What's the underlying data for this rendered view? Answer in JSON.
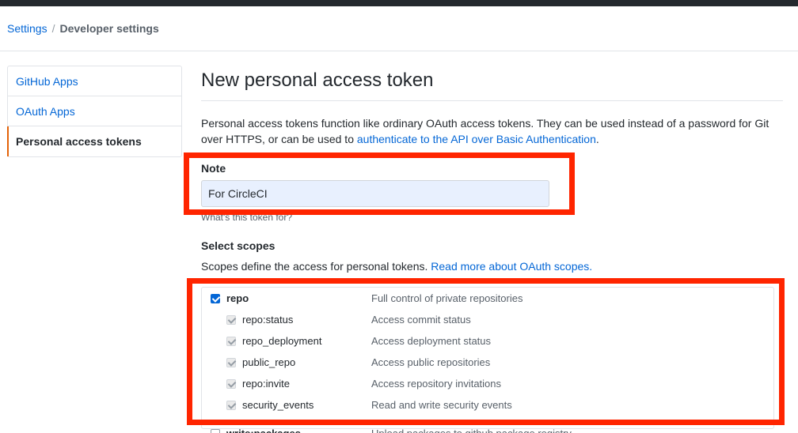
{
  "breadcrumb": {
    "settings": "Settings",
    "separator": "/",
    "current": "Developer settings"
  },
  "sidebar": {
    "items": [
      {
        "label": "GitHub Apps"
      },
      {
        "label": "OAuth Apps"
      },
      {
        "label": "Personal access tokens"
      }
    ]
  },
  "page": {
    "title": "New personal access token",
    "description_text": "Personal access tokens function like ordinary OAuth access tokens. They can be used instead of a password for Git over HTTPS, or can be used to ",
    "description_link": "authenticate to the API over Basic Authentication",
    "description_end": "."
  },
  "note": {
    "label": "Note",
    "value": "For CircleCI",
    "hint": "What's this token for?"
  },
  "scopes": {
    "label": "Select scopes",
    "desc_text": "Scopes define the access for personal tokens. ",
    "desc_link": "Read more about OAuth scopes.",
    "items": [
      {
        "name": "repo",
        "desc": "Full control of private repositories",
        "checked": true
      },
      {
        "name": "repo:status",
        "desc": "Access commit status",
        "checked": true
      },
      {
        "name": "repo_deployment",
        "desc": "Access deployment status",
        "checked": true
      },
      {
        "name": "public_repo",
        "desc": "Access public repositories",
        "checked": true
      },
      {
        "name": "repo:invite",
        "desc": "Access repository invitations",
        "checked": true
      },
      {
        "name": "security_events",
        "desc": "Read and write security events",
        "checked": true
      },
      {
        "name": "write:packages",
        "desc": "Upload packages to github package registry",
        "checked": false
      }
    ]
  },
  "colors": {
    "link": "#0366d6",
    "highlight": "#ff2500",
    "selected_accent": "#e36209",
    "autofill_bg": "#e8f0fe"
  }
}
